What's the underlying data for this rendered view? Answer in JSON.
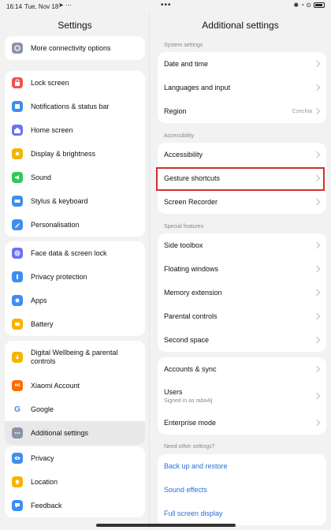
{
  "status_bar": {
    "time": "16:14",
    "date": "Tue, Nov 18",
    "left_icons": "➤ ⋯",
    "dots": "•••",
    "right_icons": "✱ ◔ ⊙"
  },
  "left": {
    "title": "Settings",
    "groups": [
      {
        "items": [
          {
            "label": "More connectivity options",
            "icon": "connectivity-icon",
            "color": "#8a94a6"
          }
        ]
      },
      {
        "items": [
          {
            "label": "Lock screen",
            "icon": "lock-icon",
            "color": "#ef5350"
          },
          {
            "label": "Notifications & status bar",
            "icon": "notifications-icon",
            "color": "#3d8ef0"
          },
          {
            "label": "Home screen",
            "icon": "home-icon",
            "color": "#6b72f0"
          },
          {
            "label": "Display & brightness",
            "icon": "brightness-icon",
            "color": "#f5b400"
          },
          {
            "label": "Sound",
            "icon": "sound-icon",
            "color": "#34c759"
          },
          {
            "label": "Stylus & keyboard",
            "icon": "keyboard-icon",
            "color": "#3d8ef0"
          },
          {
            "label": "Personalisation",
            "icon": "personalisation-icon",
            "color": "#3d8ef0"
          }
        ]
      },
      {
        "items": [
          {
            "label": "Face data & screen lock",
            "icon": "fingerprint-icon",
            "color": "#6b72f0"
          },
          {
            "label": "Privacy protection",
            "icon": "privacy-protection-icon",
            "color": "#3d8ef0"
          },
          {
            "label": "Apps",
            "icon": "apps-icon",
            "color": "#3d8ef0"
          },
          {
            "label": "Battery",
            "icon": "battery-icon",
            "color": "#f5b400"
          }
        ]
      },
      {
        "items": [
          {
            "label": "Digital Wellbeing & parental controls",
            "icon": "wellbeing-icon",
            "color": "#f5b400"
          },
          {
            "label": "Xiaomi Account",
            "icon": "xiaomi-icon",
            "color": "#ff6a00"
          },
          {
            "label": "Google",
            "icon": "google-icon",
            "color": "#ffffff"
          },
          {
            "label": "Additional settings",
            "icon": "more-icon",
            "color": "#8a94a6"
          }
        ]
      },
      {
        "items": [
          {
            "label": "Privacy",
            "icon": "privacy-icon",
            "color": "#3d8ef0"
          },
          {
            "label": "Location",
            "icon": "location-icon",
            "color": "#f5b400"
          },
          {
            "label": "Feedback",
            "icon": "feedback-icon",
            "color": "#3d8ef0"
          }
        ]
      }
    ]
  },
  "right": {
    "title": "Additional settings",
    "sections": [
      {
        "header": "System settings",
        "items": [
          {
            "label": "Date and time"
          },
          {
            "label": "Languages and input"
          },
          {
            "label": "Region",
            "value": "Czechia"
          }
        ]
      },
      {
        "header": "Accessibility",
        "items": [
          {
            "label": "Accessibility"
          },
          {
            "label": "Gesture shortcuts"
          },
          {
            "label": "Screen Recorder"
          }
        ]
      },
      {
        "header": "Special features",
        "items": [
          {
            "label": "Side toolbox"
          },
          {
            "label": "Floating windows"
          },
          {
            "label": "Memory extension"
          },
          {
            "label": "Parental controls"
          },
          {
            "label": "Second space"
          }
        ]
      },
      {
        "header": "",
        "items": [
          {
            "label": "Accounts & sync"
          },
          {
            "label": "Users",
            "sub": "Signed in as rabo4ij"
          },
          {
            "label": "Enterprise mode"
          }
        ]
      },
      {
        "header": "Need other settings?",
        "items": [
          {
            "label": "Back up and restore"
          },
          {
            "label": "Sound effects"
          },
          {
            "label": "Full screen display"
          }
        ]
      }
    ]
  },
  "colors": {
    "highlight": "#d32f2f",
    "link": "#2b6fd6",
    "active_row": "#e8e8e8"
  }
}
